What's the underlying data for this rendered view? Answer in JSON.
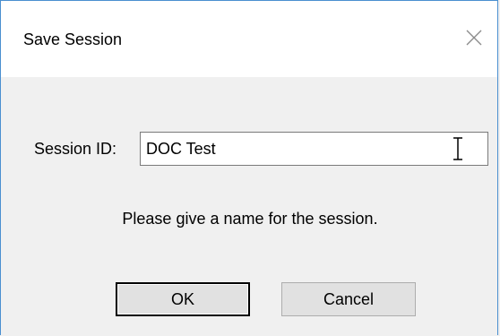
{
  "window": {
    "title": "Save Session",
    "close_icon": "close-icon"
  },
  "form": {
    "session_label": "Session ID:",
    "session_value": "DOC Test",
    "hint": "Please give a name for the session."
  },
  "buttons": {
    "ok_label": "OK",
    "cancel_label": "Cancel"
  },
  "colors": {
    "window_border": "#4a8fd0",
    "dialog_bg": "#f0f0f0",
    "titlebar_bg": "#ffffff"
  }
}
